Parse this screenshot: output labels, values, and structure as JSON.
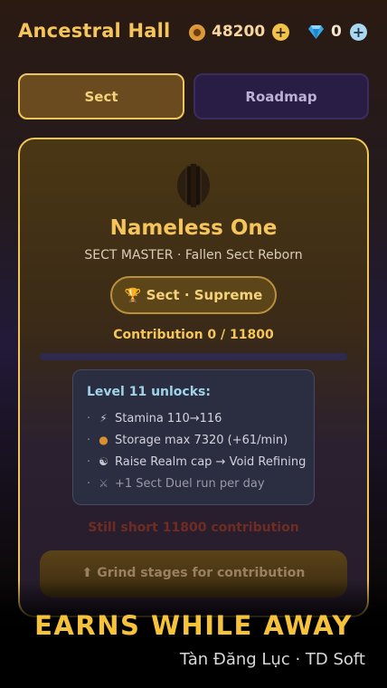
{
  "header": {
    "title": "Ancestral Hall",
    "coins": "48200",
    "gems": "0",
    "plus_symbol": "+"
  },
  "tabs": [
    {
      "label": "Sect",
      "active": true
    },
    {
      "label": "Roadmap",
      "active": false
    }
  ],
  "profile": {
    "name": "Nameless One",
    "subtitle": "SECT MASTER · Fallen Sect Reborn",
    "rank_icon": "trophy-icon",
    "rank": "Sect · Supreme"
  },
  "contribution": {
    "text": "Contribution  0 / 11800",
    "current": 0,
    "required": 11800,
    "progress": 0
  },
  "unlocks": {
    "title": "Level 11 unlocks:",
    "items": [
      {
        "icon": "lightning-icon",
        "glyph": "⚡",
        "text": "Stamina 110→116"
      },
      {
        "icon": "coin-icon",
        "glyph": "●",
        "text": "Storage max 7320 (+61/min)"
      },
      {
        "icon": "yin-yang-icon",
        "glyph": "☯",
        "text": "Raise Realm cap → Void Refining"
      },
      {
        "icon": "crossed-swords-icon",
        "glyph": "⚔",
        "text": "+1 Sect Duel run per day"
      }
    ]
  },
  "status": {
    "short": "Still short 11800 contribution"
  },
  "cta": {
    "icon": "arrow-up-icon",
    "label": "⬆ Grind stages for contribution"
  },
  "promo": {
    "banner": "EARNS WHILE AWAY",
    "credit": "Tàn Đăng Lục · TD Soft"
  },
  "colors": {
    "accent_gold": "#f5c55b",
    "card_border": "#f0c65b",
    "unlock_title": "#9fd3e8",
    "warning_text": "#6e2c22"
  }
}
